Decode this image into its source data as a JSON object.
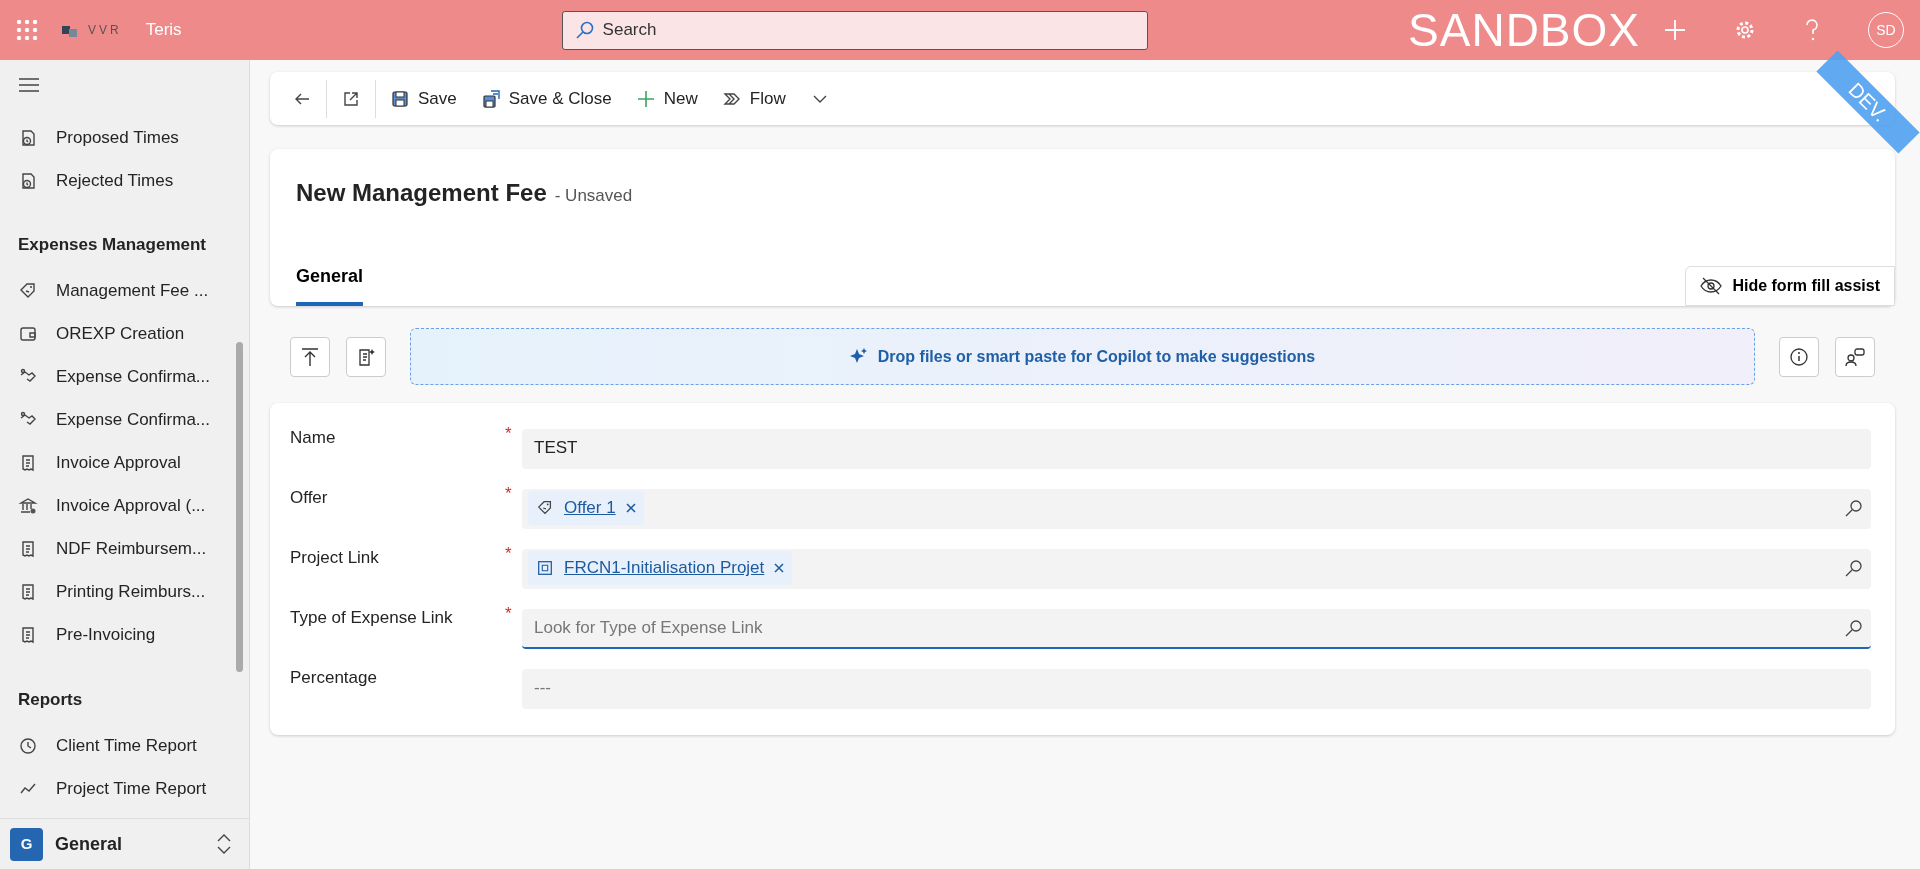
{
  "top_bar": {
    "logo_text": "VVR",
    "app_name": "Teris",
    "search_placeholder": "Search",
    "environment": "SANDBOX",
    "avatar": "SD",
    "ribbon": "DEV."
  },
  "sidebar": {
    "groups": [
      {
        "items": [
          {
            "label": "Proposed Times",
            "kind": "time"
          },
          {
            "label": "Rejected Times",
            "kind": "time"
          }
        ]
      },
      {
        "title": "Expenses Management",
        "items": [
          {
            "label": "Management Fee ...",
            "kind": "tag"
          },
          {
            "label": "OREXP Creation",
            "kind": "wallet"
          },
          {
            "label": "Expense Confirma...",
            "kind": "handshake"
          },
          {
            "label": "Expense Confirma...",
            "kind": "handshake"
          },
          {
            "label": "Invoice Approval",
            "kind": "receipt"
          },
          {
            "label": "Invoice Approval (...",
            "kind": "bank"
          },
          {
            "label": "NDF Reimbursem...",
            "kind": "receipt"
          },
          {
            "label": "Printing Reimburs...",
            "kind": "receipt"
          },
          {
            "label": "Pre-Invoicing",
            "kind": "receipt"
          }
        ]
      },
      {
        "title": "Reports",
        "items": [
          {
            "label": "Client Time Report",
            "kind": "clock"
          },
          {
            "label": "Project Time Report",
            "kind": "chart"
          }
        ]
      }
    ],
    "area": {
      "initial": "G",
      "label": "General"
    }
  },
  "toolbar": [
    {
      "kind": "back"
    },
    {
      "kind": "popout"
    },
    {
      "kind": "save",
      "label": "Save"
    },
    {
      "kind": "save_close",
      "label": "Save & Close"
    },
    {
      "kind": "new",
      "label": "New"
    },
    {
      "kind": "flow",
      "label": "Flow"
    },
    {
      "kind": "more"
    }
  ],
  "header": {
    "title": "New Management Fee",
    "status": "- Unsaved",
    "tabs": [
      {
        "label": "General",
        "selected": true
      }
    ],
    "assist_button": "Hide form fill assist"
  },
  "copilot": {
    "prompt": "Drop files or smart paste for Copilot to make suggestions"
  },
  "fields": [
    {
      "label": "Name",
      "required_mark": "*",
      "kind": "text",
      "value": "TEST"
    },
    {
      "label": "Offer",
      "required_mark": "*",
      "kind": "lookup",
      "tag": {
        "text": "Offer 1",
        "kind": "tag"
      }
    },
    {
      "label": "Project Link",
      "required_mark": "*",
      "kind": "lookup",
      "tag": {
        "text": "FRCN1-Initialisation Projet",
        "kind": "project"
      }
    },
    {
      "label": "Type of Expense Link",
      "required_mark": "*",
      "kind": "lookup",
      "placeholder": "Look for Type of Expense Link",
      "focused": true
    },
    {
      "label": "Percentage",
      "kind": "text",
      "placeholder": "---"
    }
  ]
}
